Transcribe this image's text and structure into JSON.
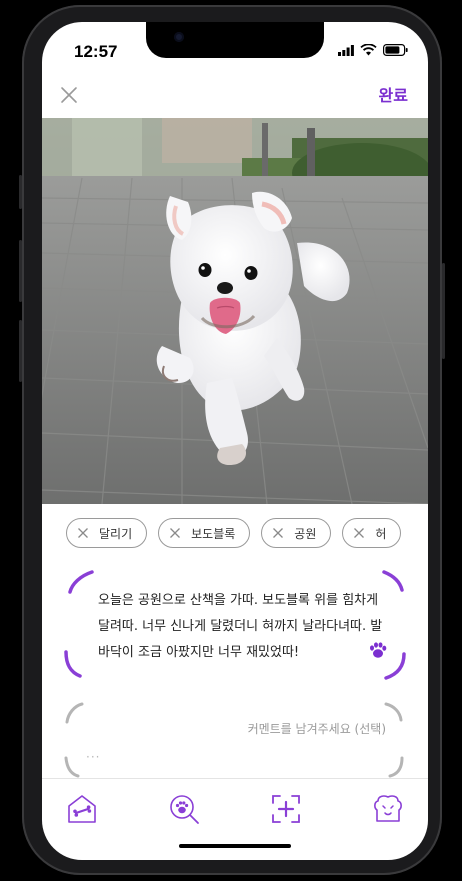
{
  "status": {
    "time": "12:57"
  },
  "header": {
    "done_label": "완료"
  },
  "tags": [
    {
      "label": "달리기"
    },
    {
      "label": "보도블록"
    },
    {
      "label": "공원"
    },
    {
      "label": "허"
    }
  ],
  "diary": {
    "text": "오늘은 공원으로 산책을 가따. 보도블록 위를 힘차게 달려따. 너무 신나게 달렸더니 혀까지 날라다녀따. 발바닥이 조금 아팠지만 너무 재밌었따!"
  },
  "comment": {
    "placeholder": "커멘트를 남겨주세요 (선택)",
    "dots": "···"
  },
  "colors": {
    "accent": "#7b2fd0",
    "accent_light": "#b77be8"
  },
  "icons": [
    "close-icon",
    "paw-icon",
    "house-bone-icon",
    "paw-search-icon",
    "add-photo-icon",
    "dog-face-icon"
  ]
}
